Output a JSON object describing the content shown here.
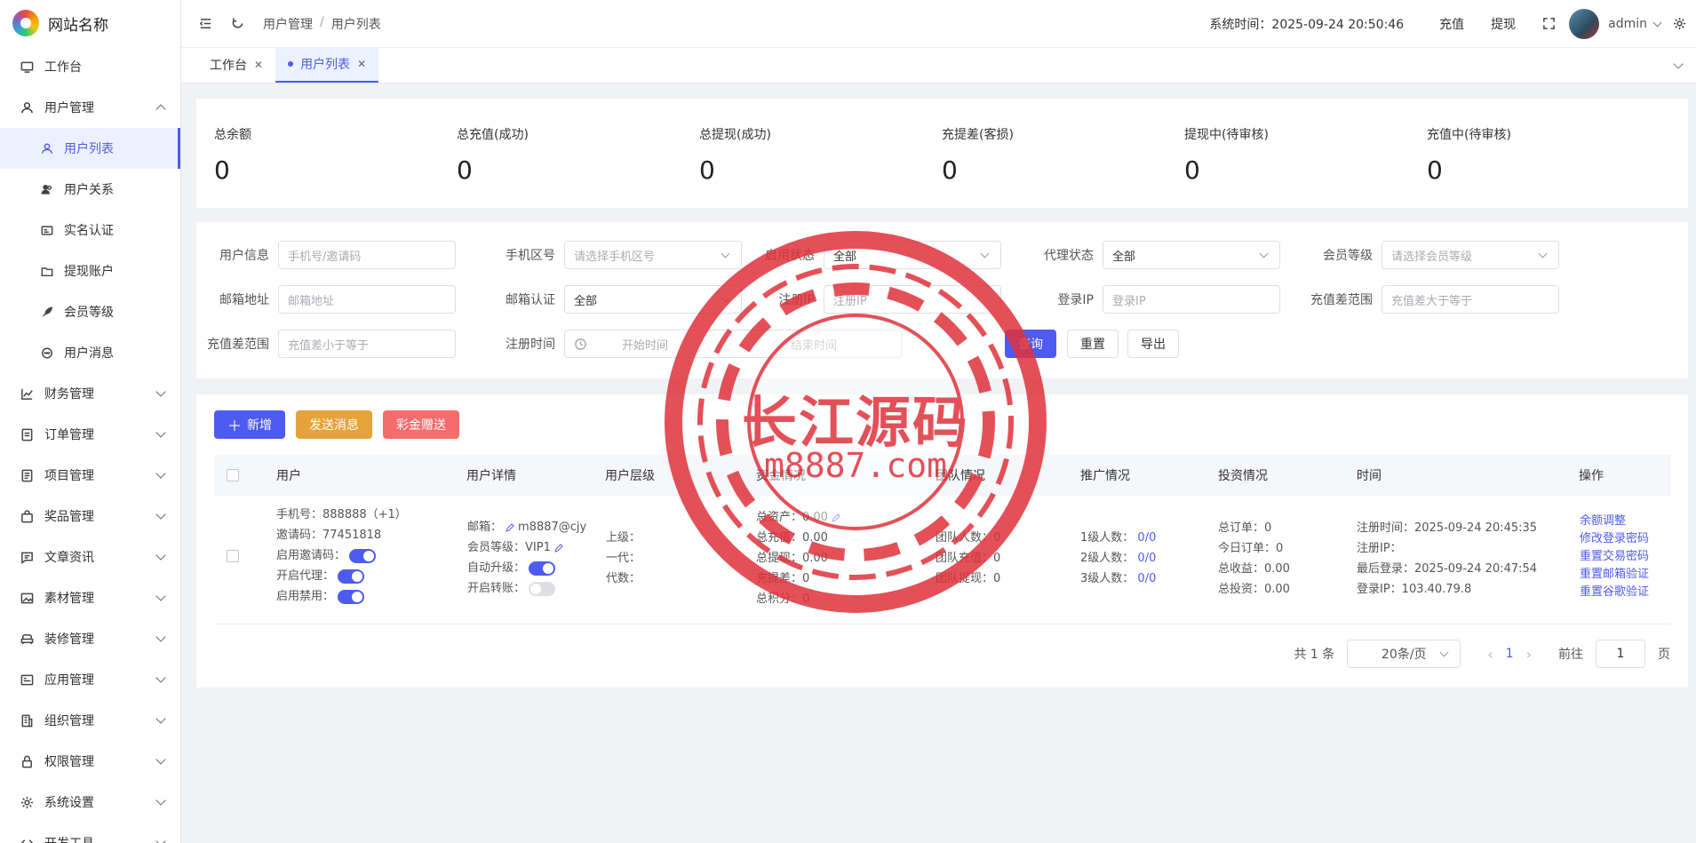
{
  "brand": {
    "name": "网站名称"
  },
  "sidebar": {
    "items": [
      {
        "label": "工作台"
      },
      {
        "label": "用户管理"
      },
      {
        "label": "财务管理"
      },
      {
        "label": "订单管理"
      },
      {
        "label": "项目管理"
      },
      {
        "label": "奖品管理"
      },
      {
        "label": "文章资讯"
      },
      {
        "label": "素材管理"
      },
      {
        "label": "装修管理"
      },
      {
        "label": "应用管理"
      },
      {
        "label": "组织管理"
      },
      {
        "label": "权限管理"
      },
      {
        "label": "系统设置"
      },
      {
        "label": "开发工具"
      }
    ],
    "sub_items": [
      {
        "label": "用户列表"
      },
      {
        "label": "用户关系"
      },
      {
        "label": "实名认证"
      },
      {
        "label": "提现账户"
      },
      {
        "label": "会员等级"
      },
      {
        "label": "用户消息"
      }
    ]
  },
  "header": {
    "breadcrumb": [
      "用户管理",
      "用户列表"
    ],
    "separator": "/",
    "system_time": "系统时间：2025-09-24 20:50:46",
    "recharge": "充值",
    "withdraw": "提现",
    "user": "admin"
  },
  "tabs": [
    {
      "label": "工作台"
    },
    {
      "label": "用户列表"
    }
  ],
  "stats": [
    {
      "label": "总余额",
      "value": "0"
    },
    {
      "label": "总充值(成功)",
      "value": "0"
    },
    {
      "label": "总提现(成功)",
      "value": "0"
    },
    {
      "label": "充提差(客损)",
      "value": "0"
    },
    {
      "label": "提现中(待审核)",
      "value": "0"
    },
    {
      "label": "充值中(待审核)",
      "value": "0"
    }
  ],
  "filters": {
    "user_info": {
      "label": "用户信息",
      "placeholder": "手机号/邀请码"
    },
    "phone_area": {
      "label": "手机区号",
      "placeholder": "请选择手机区号"
    },
    "enable_status": {
      "label": "启用状态",
      "value": "全部"
    },
    "agent_status": {
      "label": "代理状态",
      "value": "全部"
    },
    "member_level": {
      "label": "会员等级",
      "placeholder": "请选择会员等级"
    },
    "email": {
      "label": "邮箱地址",
      "placeholder": "邮箱地址"
    },
    "email_verify": {
      "label": "邮箱认证",
      "value": "全部"
    },
    "reg_ip": {
      "label": "注册IP",
      "placeholder": "注册IP"
    },
    "login_ip": {
      "label": "登录IP",
      "placeholder": "登录IP"
    },
    "diff_min": {
      "label": "充值差范围",
      "placeholder": "充值差大于等于"
    },
    "diff_max": {
      "label": "充值差范围",
      "placeholder": "充值差小于等于"
    },
    "reg_time": {
      "label": "注册时间",
      "start": "开始时间",
      "end": "结束时间"
    },
    "query": "查询",
    "reset": "重置",
    "export": "导出"
  },
  "actions": {
    "add": "新增",
    "send_message": "发送消息",
    "gift": "彩金赠送"
  },
  "table": {
    "columns": [
      "用户",
      "用户详情",
      "用户层级",
      "资金情况",
      "团队情况",
      "推广情况",
      "投资情况",
      "时间",
      "操作"
    ],
    "row": {
      "user": {
        "phone": "手机号：888888（+1）",
        "invite": "邀请码：77451818",
        "invite_enable": "启用邀请码：",
        "agent": "开启代理：",
        "ban": "启用禁用："
      },
      "detail": {
        "email": "邮箱：",
        "email_value": "m8887@cjy",
        "level": "会员等级：VIP1",
        "auto_up": "自动升级：",
        "transfer": "开启转账："
      },
      "hier": {
        "parent": "上级：",
        "first": "一代：",
        "gen": "代数："
      },
      "funds": {
        "assets": "总资产：0.00",
        "recharge": "总充值：0.00",
        "withdraw": "总提现：0.00",
        "diff": "充提差：0",
        "points": "总积分：0"
      },
      "team": {
        "count": "团队人数：0",
        "recharge": "团队充值：0",
        "withdraw": "团队提现：0"
      },
      "promo": {
        "l1": "1级人数：",
        "l2": "2级人数：",
        "l3": "3级人数：",
        "v1": "0/0",
        "v2": "0/0",
        "v3": "0/0"
      },
      "invest": {
        "orders": "总订单：0",
        "today": "今日订单：0",
        "income": "总收益：0.00",
        "total": "总投资：0.00"
      },
      "time": {
        "reg": "注册时间：2025-09-24 20:45:35",
        "reg_ip": "注册IP：",
        "last": "最后登录：2025-09-24 20:47:54",
        "login_ip": "登录IP：103.40.79.8"
      },
      "ops": [
        "余额调整",
        "修改登录密码",
        "重置交易密码",
        "重置邮箱验证",
        "重置谷歌验证"
      ]
    }
  },
  "pagination": {
    "total": "共 1 条",
    "size": "20条/页",
    "page": "1",
    "goto": "前往",
    "goto_value": "1",
    "unit": "页"
  },
  "watermark": {
    "title": "长江源码",
    "url": "m8887.com"
  },
  "colors": {
    "primary": "#4e5bf0",
    "warning": "#e6a23c",
    "danger": "#f56c6c",
    "stamp": "#e0323b"
  }
}
